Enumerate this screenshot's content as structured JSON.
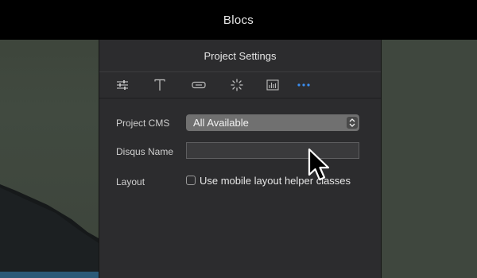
{
  "window": {
    "title": "Blocs"
  },
  "panel": {
    "title": "Project Settings",
    "toolbar": [
      {
        "name": "sliders-icon"
      },
      {
        "name": "text-icon"
      },
      {
        "name": "button-icon"
      },
      {
        "name": "spinner-icon"
      },
      {
        "name": "chart-icon"
      },
      {
        "name": "more-icon",
        "active": true,
        "color": "#3b8ef0"
      }
    ],
    "project_cms": {
      "label": "Project CMS",
      "value": "All Available"
    },
    "disqus_name": {
      "label": "Disqus Name",
      "value": ""
    },
    "layout": {
      "label": "Layout",
      "checkbox_label": "Use mobile layout helper classes",
      "checked": false
    }
  },
  "colors": {
    "accent": "#3b8ef0",
    "panel_bg": "#2c2c2e",
    "titlebar_bg": "#000000"
  }
}
